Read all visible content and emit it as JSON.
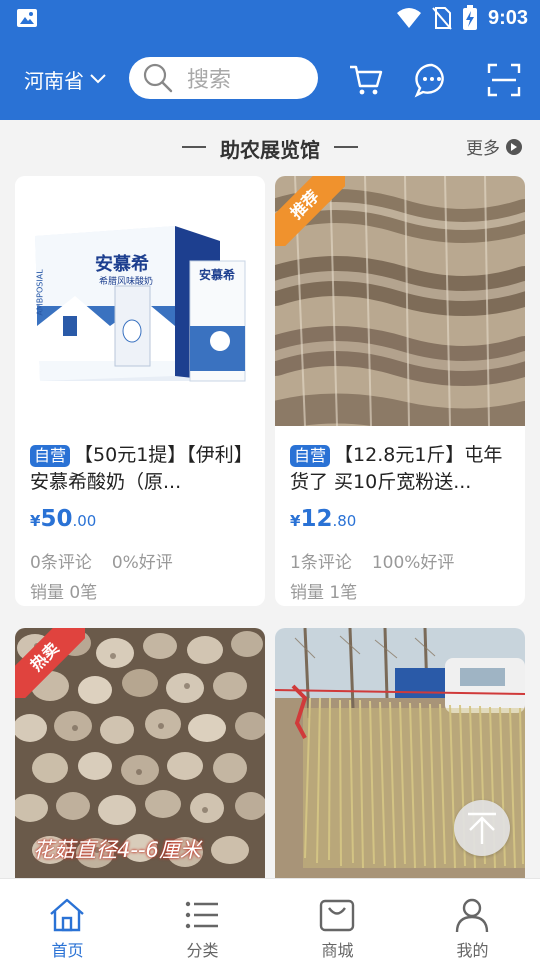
{
  "status_bar": {
    "time": "9:03"
  },
  "header": {
    "region": "河南省",
    "search_placeholder": "搜索"
  },
  "section": {
    "title": "助农展览馆",
    "more": "更多"
  },
  "products": [
    {
      "tag": "自营",
      "title": "【50元1提】【伊利】安慕希酸奶（原...",
      "price_currency": "¥",
      "price_int": "50",
      "price_dec": ".00",
      "reviews": "0条评论",
      "rating": "0%好评",
      "sales": "销量 0笔",
      "image_text": {
        "brand": "安慕希",
        "sub": "希腊风味酸奶",
        "box_brand": "AMBPOSIAL"
      }
    },
    {
      "tag": "自营",
      "badge": "推荐",
      "title": "【12.8元1斤】屯年货了 买10斤宽粉送...",
      "price_currency": "¥",
      "price_int": "12",
      "price_dec": ".80",
      "reviews": "1条评论",
      "rating": "100%好评",
      "sales": "销量 1笔"
    },
    {
      "badge": "热卖",
      "image_caption": "花菇直径4--6厘米"
    },
    {}
  ],
  "bottom_nav": [
    {
      "label": "首页",
      "icon": "home-icon",
      "active": true
    },
    {
      "label": "分类",
      "icon": "list-icon",
      "active": false
    },
    {
      "label": "商城",
      "icon": "bag-icon",
      "active": false
    },
    {
      "label": "我的",
      "icon": "user-icon",
      "active": false
    }
  ],
  "colors": {
    "brand": "#2a72d5",
    "badge_recommend": "#f0922d",
    "badge_hot": "#e0433e"
  }
}
